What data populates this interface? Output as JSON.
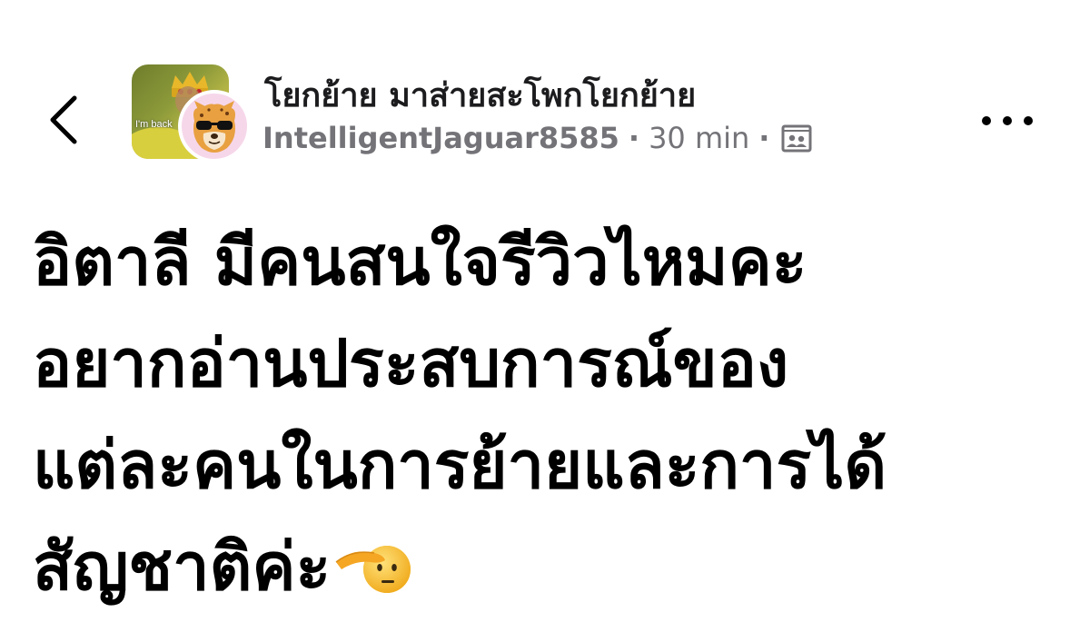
{
  "header": {
    "back_icon": "chevron-left-icon",
    "group_name": "โยกย้าย มาส่ายสะโพกโยกย้าย",
    "group_avatar_text": "I'm back",
    "username": "IntelligentJaguar8585",
    "separator": "·",
    "time_ago": "30 min",
    "media_icon": "photo-gallery-icon",
    "more_icon": "more-horizontal-icon"
  },
  "post": {
    "lines": [
      "อิตาลี มีคนสนใจรีวิวไหมคะ",
      "อยากอ่านประสบการณ์ของ",
      "แต่ละคนในการย้ายและการได้",
      "สัญชาติค่ะ"
    ],
    "emoji": "saluting-face-emoji"
  },
  "colors": {
    "text_primary": "#000000",
    "text_secondary": "#737378",
    "background": "#ffffff",
    "group_avatar_green": "#8c9a3a",
    "user_avatar_pink": "#f6d7ea"
  }
}
